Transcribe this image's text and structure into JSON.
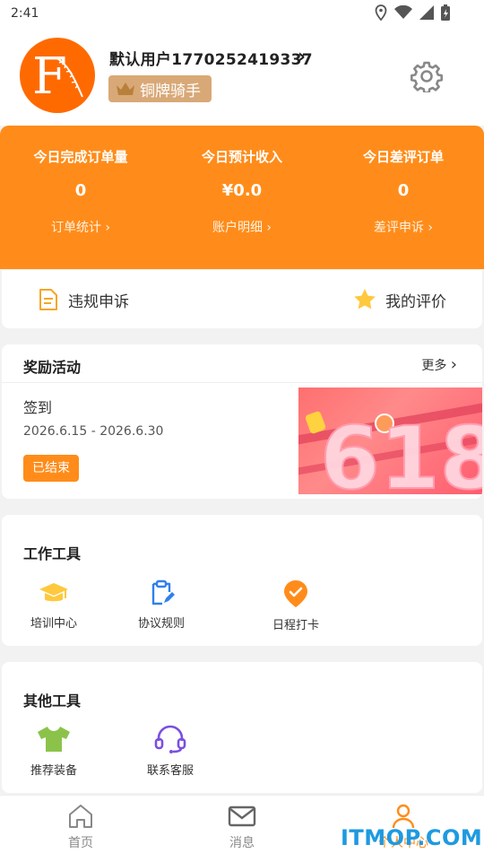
{
  "status_bar": {
    "time": "2:41"
  },
  "profile": {
    "username": "默认用户1770252419337",
    "badge_label": "铜牌骑手",
    "avatar_letter": "F"
  },
  "stats": [
    {
      "title": "今日完成订单量",
      "value": "0",
      "link": "订单统计"
    },
    {
      "title": "今日预计收入",
      "value": "¥0.0",
      "link": "账户明细"
    },
    {
      "title": "今日差评订单",
      "value": "0",
      "link": "差评申诉"
    }
  ],
  "quick_links": {
    "violation": "违规申诉",
    "my_review": "我的评价"
  },
  "rewards": {
    "title": "奖励活动",
    "more": "更多",
    "activity_title": "签到",
    "activity_date": "2026.6.15 - 2026.6.30",
    "status": "已结束",
    "banner_text": "618"
  },
  "work_tools": {
    "title": "工作工具",
    "items": [
      {
        "label": "培训中心"
      },
      {
        "label": "协议规则"
      },
      {
        "label": "日程打卡"
      }
    ]
  },
  "other_tools": {
    "title": "其他工具",
    "items": [
      {
        "label": "推荐装备"
      },
      {
        "label": "联系客服"
      }
    ]
  },
  "bottom_nav": [
    {
      "label": "首页"
    },
    {
      "label": "消息"
    },
    {
      "label": "个人中心"
    }
  ],
  "watermark": "ITMOP.COM",
  "colors": {
    "accent": "#ff8c1a",
    "badge": "#d9a877",
    "watermark": "#1e9ae0"
  }
}
